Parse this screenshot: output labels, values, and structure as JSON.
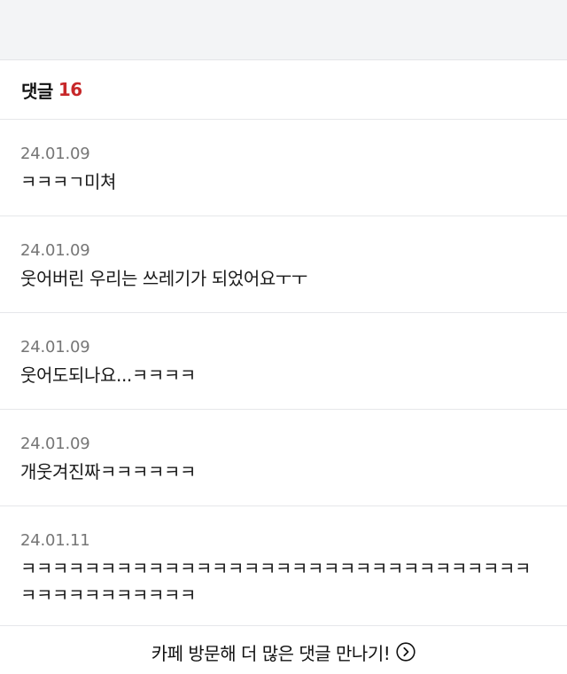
{
  "header": {
    "label": "댓글",
    "count": "16"
  },
  "comments": [
    {
      "date": "24.01.09",
      "text": "ㅋㅋㅋㄱ미쳐"
    },
    {
      "date": "24.01.09",
      "text": "웃어버린 우리는 쓰레기가 되었어요ㅜㅜ"
    },
    {
      "date": "24.01.09",
      "text": "웃어도되나요...ㅋㅋㅋㅋ"
    },
    {
      "date": "24.01.09",
      "text": "개웃겨진짜ㅋㅋㅋㅋㅋㅋ"
    },
    {
      "date": "24.01.11",
      "text": "ㅋㅋㅋㅋㅋㅋㅋㅋㅋㅋㅋㅋㅋㅋㅋㅋㅋㅋㅋㅋㅋㅋㅋㅋㅋㅋㅋㅋㅋㅋㅋㅋㅋㅋㅋㅋㅋㅋㅋㅋㅋㅋㅋ"
    }
  ],
  "footer": {
    "link_label": "카페 방문해 더 많은 댓글 만나기!",
    "icon": "chevron-right-circle-icon"
  },
  "colors": {
    "count_accent": "#c7282a",
    "top_bar": "#f3f4f6",
    "divider": "#e6e7ea"
  }
}
